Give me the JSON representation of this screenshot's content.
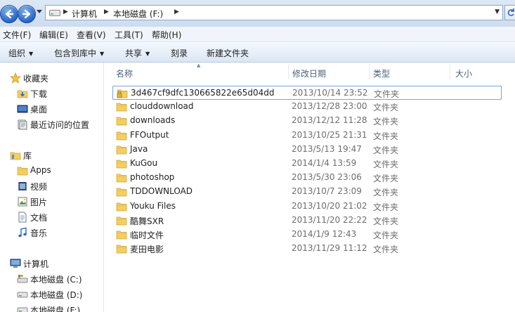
{
  "address": {
    "crumbs": [
      "计算机",
      "本地磁盘 (F:)"
    ]
  },
  "menu": [
    "文件(F)",
    "编辑(E)",
    "查看(V)",
    "工具(T)",
    "帮助(H)"
  ],
  "commands": {
    "organize": "组织",
    "include_library": "包含到库中",
    "share": "共享",
    "burn": "刻录",
    "new_folder": "新建文件夹"
  },
  "nav": {
    "favorites": {
      "title": "收藏夹",
      "items": [
        "下载",
        "桌面",
        "最近访问的位置"
      ]
    },
    "libraries": {
      "title": "库",
      "items": [
        "Apps",
        "视频",
        "图片",
        "文档",
        "音乐"
      ]
    },
    "computer": {
      "title": "计算机",
      "items": [
        "本地磁盘 (C:)",
        "本地磁盘 (D:)",
        "本地磁盘 (F:)"
      ]
    }
  },
  "columns": {
    "name": "名称",
    "date": "修改日期",
    "type": "类型",
    "size": "大小"
  },
  "files": [
    {
      "name": "3d467cf9dfc130665822e65d04dd",
      "date": "2013/10/14 23:52",
      "type": "文件夹",
      "locked": true
    },
    {
      "name": "clouddownload",
      "date": "2013/12/28 23:00",
      "type": "文件夹"
    },
    {
      "name": "downloads",
      "date": "2013/12/12 11:28",
      "type": "文件夹"
    },
    {
      "name": "FFOutput",
      "date": "2013/10/25 21:31",
      "type": "文件夹"
    },
    {
      "name": "Java",
      "date": "2013/5/13 19:47",
      "type": "文件夹"
    },
    {
      "name": "KuGou",
      "date": "2014/1/4 13:59",
      "type": "文件夹"
    },
    {
      "name": "photoshop",
      "date": "2013/5/30 23:06",
      "type": "文件夹"
    },
    {
      "name": "TDDOWNLOAD",
      "date": "2013/10/7 23:09",
      "type": "文件夹"
    },
    {
      "name": "Youku Files",
      "date": "2013/10/20 21:02",
      "type": "文件夹"
    },
    {
      "name": "酷舞SXR",
      "date": "2013/11/20 22:22",
      "type": "文件夹"
    },
    {
      "name": "临时文件",
      "date": "2014/1/9 12:43",
      "type": "文件夹"
    },
    {
      "name": "麦田电影",
      "date": "2013/11/29 11:12",
      "type": "文件夹"
    }
  ]
}
